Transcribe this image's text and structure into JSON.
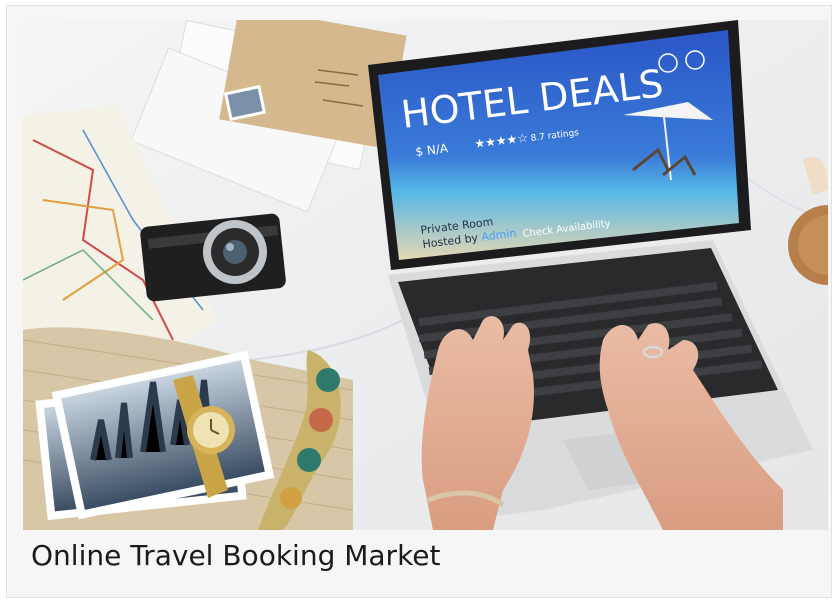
{
  "caption": "Online Travel Booking Market",
  "screen": {
    "title": "HOTEL DEALS",
    "price": "$ N/A",
    "rating_stars": "★★★★☆",
    "rating_text": "8.7 ratings",
    "room_line1": "Private Room",
    "room_line2_prefix": "Hosted by",
    "room_line2_host": "Admin",
    "button": "Check Availability"
  },
  "colors": {
    "screen_blue": "#2a56c6",
    "screen_sea": "#3fa3d8",
    "accent_link": "#3fa0ff"
  }
}
